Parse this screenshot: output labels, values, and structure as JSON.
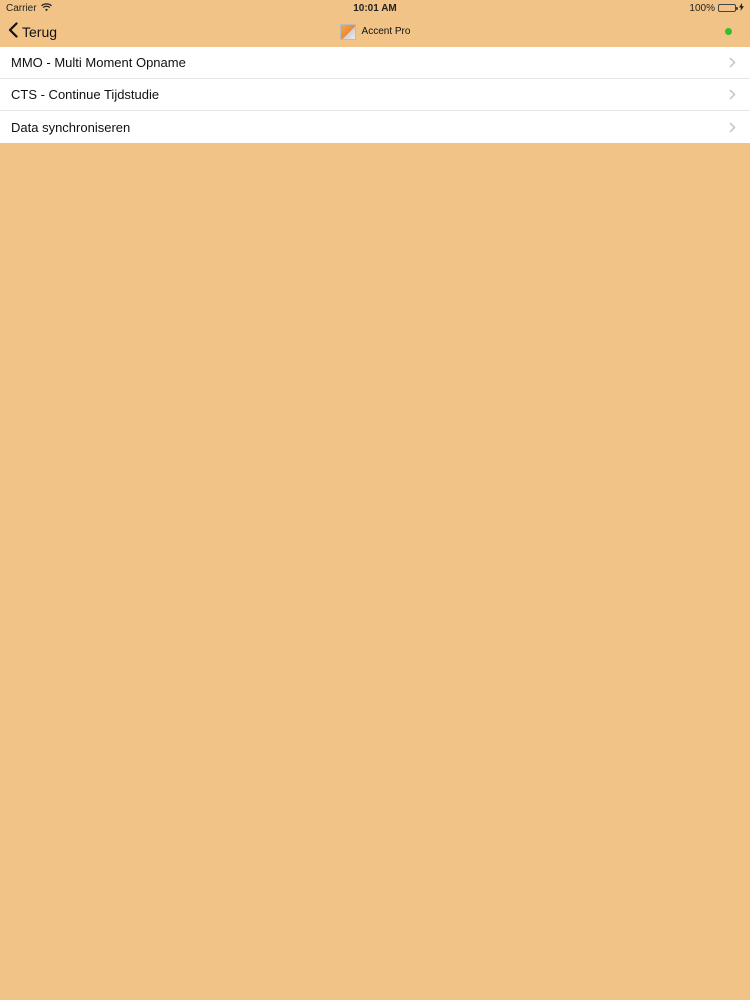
{
  "status_bar": {
    "carrier": "Carrier",
    "time": "10:01 AM",
    "battery": "100%"
  },
  "nav": {
    "back_label": "Terug",
    "title": "Accent Pro",
    "status_color": "#2fbf2f"
  },
  "menu": {
    "items": [
      {
        "label": "MMO - Multi Moment Opname"
      },
      {
        "label": "CTS - Continue Tijdstudie"
      },
      {
        "label": "Data synchroniseren"
      }
    ]
  },
  "colors": {
    "background": "#F2C386",
    "list_background": "#ffffff"
  }
}
